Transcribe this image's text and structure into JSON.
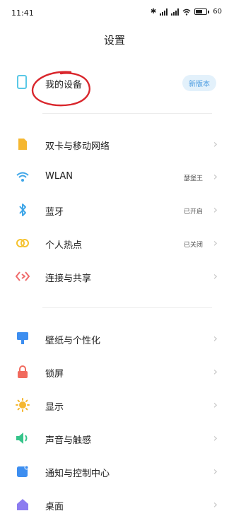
{
  "status": {
    "time": "11:41",
    "battery": "60"
  },
  "page_title": "设置",
  "device": {
    "label": "我的设备",
    "badge": "新版本"
  },
  "section1": [
    {
      "label": "双卡与移动网络",
      "value": "",
      "icon": "sim-card-icon",
      "color": "#f5b731"
    },
    {
      "label": "WLAN",
      "value": "瑟堡王",
      "icon": "wifi-icon",
      "color": "#3fa6e8"
    },
    {
      "label": "蓝牙",
      "value": "已开启",
      "icon": "bluetooth-icon",
      "color": "#3fa6e8"
    },
    {
      "label": "个人热点",
      "value": "已关闭",
      "icon": "hotspot-icon",
      "color": "#f5c331"
    },
    {
      "label": "连接与共享",
      "value": "",
      "icon": "share-icon",
      "color": "#ef6b6b"
    }
  ],
  "section2": [
    {
      "label": "壁纸与个性化",
      "icon": "wallpaper-icon",
      "color": "#3d8ef0"
    },
    {
      "label": "锁屏",
      "icon": "lock-icon",
      "color": "#f16a5e"
    },
    {
      "label": "显示",
      "icon": "brightness-icon",
      "color": "#f5b731"
    },
    {
      "label": "声音与触感",
      "icon": "speaker-icon",
      "color": "#35c48a"
    },
    {
      "label": "通知与控制中心",
      "icon": "notification-icon",
      "color": "#3d8ef0"
    },
    {
      "label": "桌面",
      "icon": "home-icon",
      "color": "#8c7cf0"
    }
  ]
}
